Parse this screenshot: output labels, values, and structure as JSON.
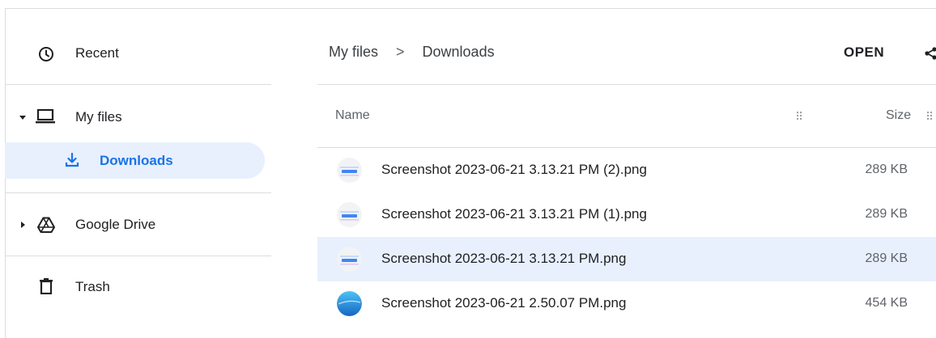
{
  "sidebar": {
    "items": [
      {
        "label": "Recent",
        "icon": "clock-icon"
      },
      {
        "label": "My files",
        "icon": "laptop-icon",
        "expanded": true
      },
      {
        "label": "Downloads",
        "icon": "download-icon",
        "selected": true
      },
      {
        "label": "Google Drive",
        "icon": "google-drive-icon",
        "expanded": false
      },
      {
        "label": "Trash",
        "icon": "trash-icon"
      }
    ]
  },
  "breadcrumb": {
    "root": "My files",
    "separator": ">",
    "current": "Downloads"
  },
  "toolbar": {
    "open_label": "OPEN"
  },
  "table": {
    "columns": {
      "name": "Name",
      "size": "Size"
    },
    "rows": [
      {
        "name": "Screenshot 2023-06-21 3.13.21 PM (2).png",
        "size": "289 KB",
        "thumb": "screenshot",
        "selected": false
      },
      {
        "name": "Screenshot 2023-06-21 3.13.21 PM (1).png",
        "size": "289 KB",
        "thumb": "screenshot",
        "selected": false
      },
      {
        "name": "Screenshot 2023-06-21 3.13.21 PM.png",
        "size": "289 KB",
        "thumb": "screenshot",
        "selected": true
      },
      {
        "name": "Screenshot 2023-06-21 2.50.07 PM.png",
        "size": "454 KB",
        "thumb": "blue",
        "selected": false
      }
    ]
  },
  "colors": {
    "accent": "#1a73e8",
    "selected_bg": "#e8f0fe",
    "divider": "#dadce0"
  }
}
